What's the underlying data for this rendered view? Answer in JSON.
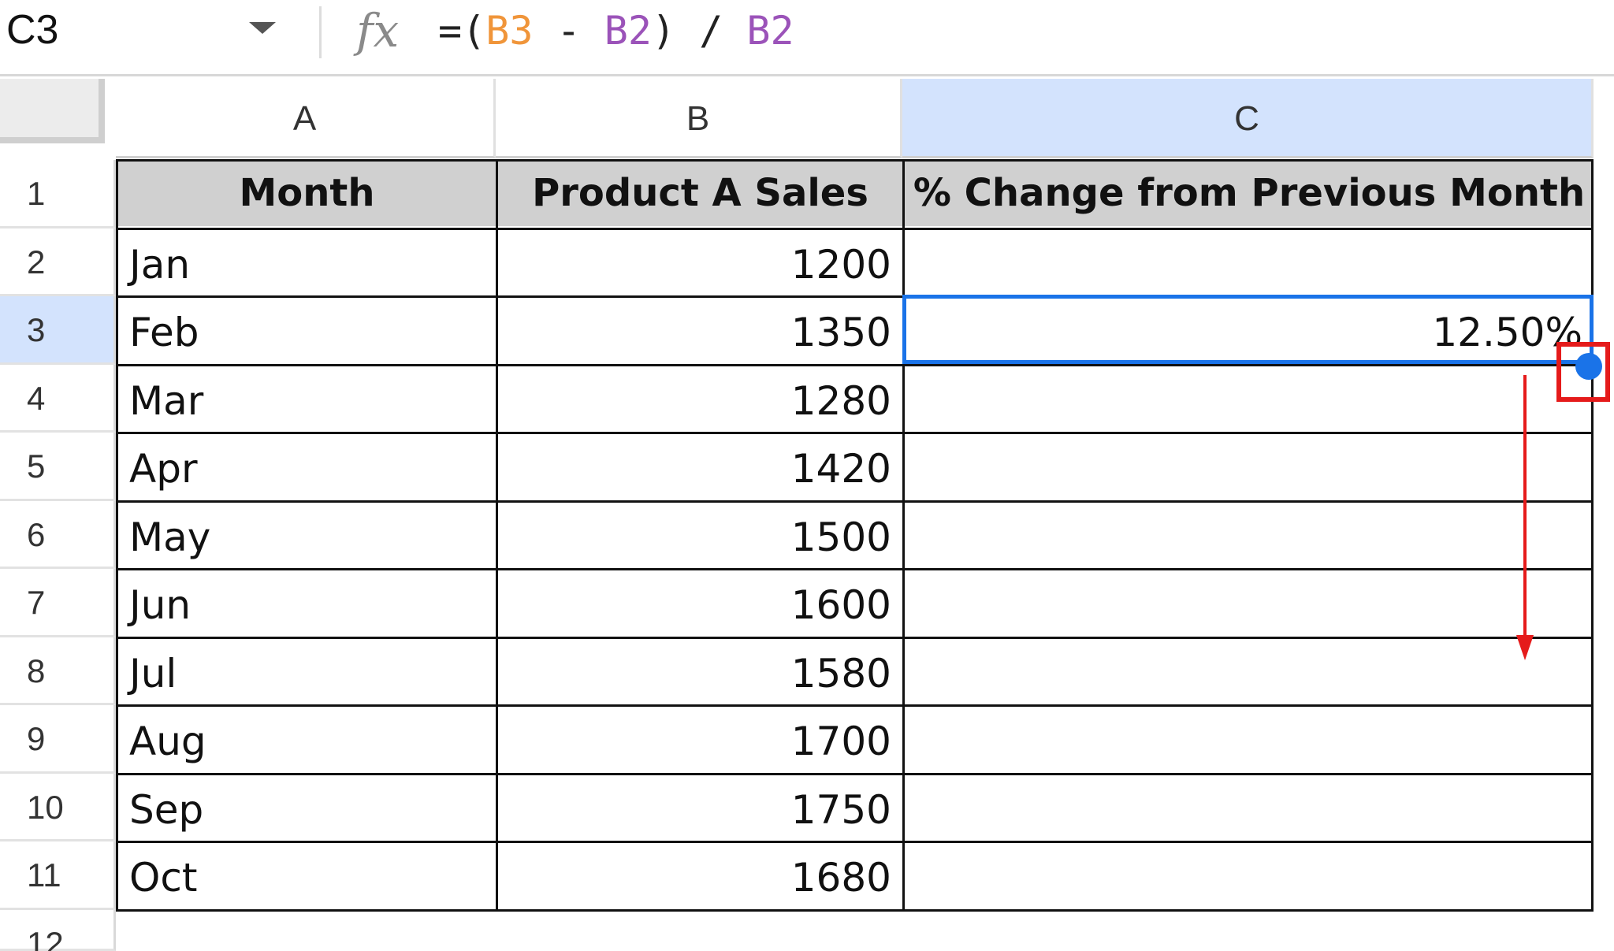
{
  "formula_bar": {
    "name_box": "C3",
    "fx_label": "fx",
    "formula_parts": [
      "=(",
      "B3",
      " - ",
      "B2",
      ") / ",
      "B2"
    ]
  },
  "columns": [
    "A",
    "B",
    "C"
  ],
  "row_numbers": [
    "1",
    "2",
    "3",
    "4",
    "5",
    "6",
    "7",
    "8",
    "9",
    "10",
    "11",
    "12"
  ],
  "selected": {
    "cell": "C3",
    "column": "C",
    "row": "3"
  },
  "table": {
    "headers": [
      "Month",
      "Product A Sales",
      "% Change from Previous Month"
    ],
    "rows": [
      {
        "month": "Jan",
        "sales": "1200",
        "change": ""
      },
      {
        "month": "Feb",
        "sales": "1350",
        "change": "12.50%"
      },
      {
        "month": "Mar",
        "sales": "1280",
        "change": ""
      },
      {
        "month": "Apr",
        "sales": "1420",
        "change": ""
      },
      {
        "month": "May",
        "sales": "1500",
        "change": ""
      },
      {
        "month": "Jun",
        "sales": "1600",
        "change": ""
      },
      {
        "month": "Jul",
        "sales": "1580",
        "change": ""
      },
      {
        "month": "Aug",
        "sales": "1700",
        "change": ""
      },
      {
        "month": "Sep",
        "sales": "1750",
        "change": ""
      },
      {
        "month": "Oct",
        "sales": "1680",
        "change": ""
      }
    ]
  },
  "colors": {
    "selection": "#1a73e8",
    "selected_header_bg": "#d3e3fd",
    "annotation_red": "#e51b1b",
    "ref_b3": "#f0953a",
    "ref_b2": "#9b53b9",
    "table_header_bg": "#d0d0d0"
  }
}
